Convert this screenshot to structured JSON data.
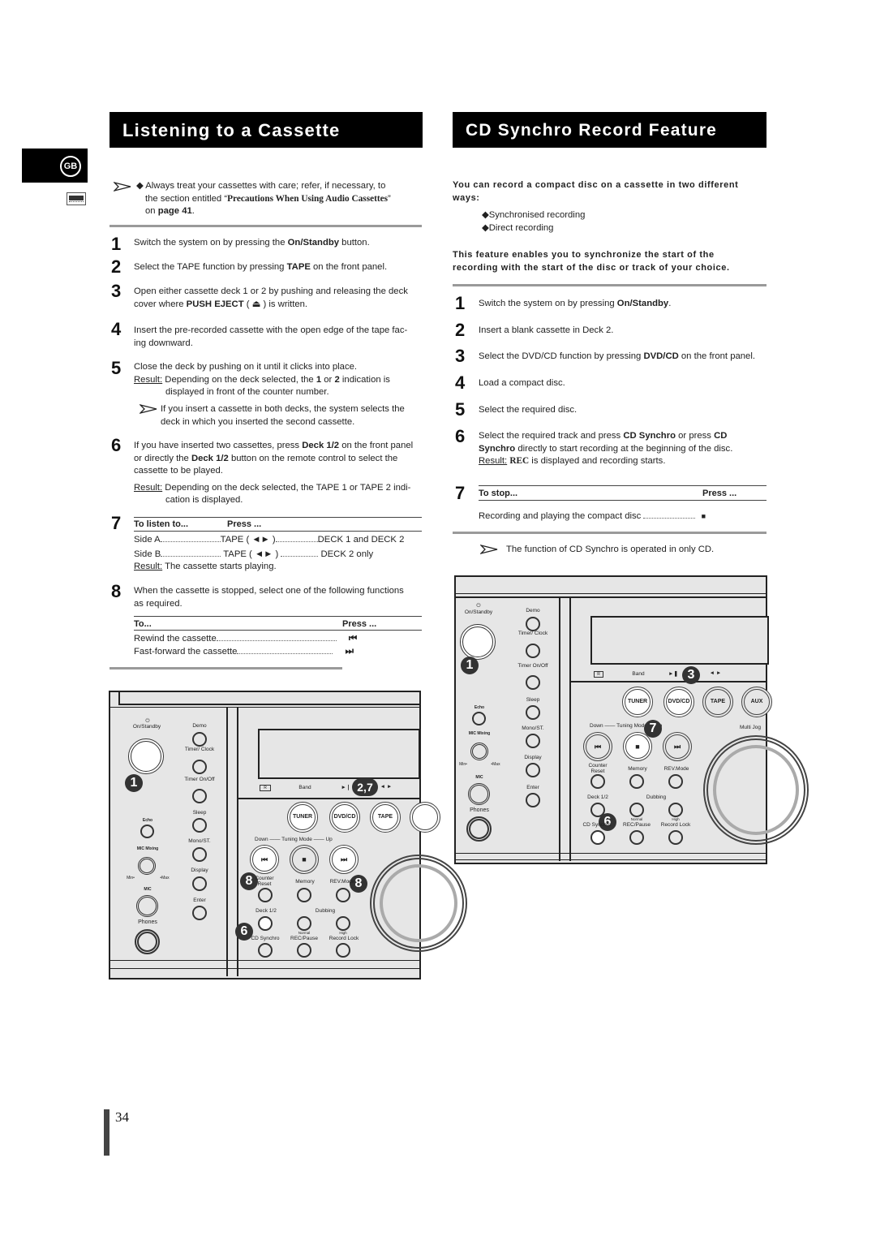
{
  "sidebar": {
    "language_badge": "GB",
    "icon": "cassette-icon"
  },
  "left": {
    "title": "Listening to a Cassette",
    "note": {
      "prefix": "Always treat your cassettes with care; refer, if necessary, to",
      "line2_pre": "the section entitled “",
      "ref": "Precautions When Using Audio Cassettes",
      "line2_post": "”",
      "line3_pre": "on ",
      "page_ref": "page 41",
      "line3_post": "."
    },
    "steps": [
      {
        "n": "1",
        "text_pre": "Switch the system on by pressing the ",
        "bold": "On/Standby",
        "text_post": " button."
      },
      {
        "n": "2",
        "text_pre": "Select the TAPE function by pressing ",
        "bold": "TAPE",
        "text_post": " on the front panel."
      },
      {
        "n": "3",
        "line1": "Open either cassette deck 1 or 2 by pushing and releasing the deck",
        "line2_pre": "cover where ",
        "bold": "PUSH EJECT",
        "line2_post": " ( ⏏ ) is written."
      },
      {
        "n": "4",
        "line1": "Insert the pre-recorded cassette with the open edge of the tape fac-",
        "line2": "ing downward."
      },
      {
        "n": "5",
        "line1": "Close the deck by pushing on it until it clicks into place.",
        "result_label": "Result:",
        "result_pre": " Depending on the deck selected, the ",
        "b1": "1",
        "mid": " or ",
        "b2": "2",
        "result_post": " indication is",
        "result_line2": "displayed in front of the counter number.",
        "tip1": "If you insert a cassette in both decks, the system selects the",
        "tip2": "deck in which you inserted the second cassette."
      },
      {
        "n": "6",
        "line1_pre": "If you have inserted two cassettes, press ",
        "line1_bold": "Deck 1/2",
        "line1_post": " on the front panel",
        "line2_pre": "or directly the ",
        "line2_bold": "Deck 1/2",
        "line2_post": " button on the remote control to select the",
        "line3": "cassette to be played.",
        "result_label": "Result:",
        "result_text": " Depending on the deck selected, the TAPE 1 or TAPE 2 indi-",
        "result_line2": "cation is displayed."
      },
      {
        "n": "7",
        "col1": "To listen to...",
        "col2": "Press ...",
        "rows": [
          {
            "side": "Side A",
            "press": "TAPE ( ◄► )",
            "deck": "DECK 1 and DECK 2"
          },
          {
            "side": "Side B",
            "press": "TAPE ( ◄► )",
            "deck": "DECK 2  only"
          }
        ],
        "result_label": "Result:",
        "result_text": " The cassette starts playing."
      },
      {
        "n": "8",
        "line1": "When the cassette is stopped, select one of the following functions",
        "line2": "as required.",
        "col1": "To...",
        "col2": "Press ...",
        "rows": [
          {
            "action": "Rewind the cassette",
            "icon": "⏮"
          },
          {
            "action": "Fast-forward the cassette",
            "icon": "⏭"
          }
        ]
      }
    ]
  },
  "right": {
    "title": "CD Synchro Record Feature",
    "intro1": "You can record a compact disc on a cassette in two different",
    "intro2": "ways:",
    "bullets": [
      "Synchronised recording",
      "Direct recording"
    ],
    "intro3": "This feature enables you to synchronize the start of the",
    "intro4": "recording with the start of the disc or track of your choice.",
    "steps": [
      {
        "n": "1",
        "pre": "Switch the system on by pressing ",
        "bold": "On/Standby",
        "post": "."
      },
      {
        "n": "2",
        "pre": "Insert a blank cassette in Deck 2.",
        "bold": "",
        "post": ""
      },
      {
        "n": "3",
        "pre": "Select the DVD/CD function by pressing ",
        "bold": "DVD/CD",
        "post": " on the front panel."
      },
      {
        "n": "4",
        "pre": "Load a compact disc.",
        "bold": "",
        "post": ""
      },
      {
        "n": "5",
        "pre": "Select the required disc.",
        "bold": "",
        "post": ""
      },
      {
        "n": "6",
        "line1_pre": "Select the required track and press ",
        "line1_bold": "CD Synchro",
        "line1_mid": " or press ",
        "line1_bold2": "CD",
        "line2_bold": "Synchro",
        "line2_post": " directly to start recording at the beginning of the disc.",
        "result_label": "Result:",
        "result_rec": "REC",
        "result_post": " is displayed and recording starts."
      },
      {
        "n": "7",
        "col1": "To stop...",
        "col2": "Press ...",
        "row": "Recording and playing the compact disc",
        "icon": "■"
      }
    ],
    "note": "The function of CD Synchro is operated in only CD."
  },
  "panel": {
    "on_standby": "On/Standby",
    "demo": "Demo",
    "timer_clock": "Timer/ Clock",
    "timer_onoff": "Timer On/Off",
    "sleep": "Sleep",
    "echo": "Echo",
    "mono_st": "Mono/ST.",
    "mic_mixing": "MIC Mixing",
    "min": "Min•",
    "max": "•Max",
    "display": "Display",
    "mic": "MIC",
    "enter": "Enter",
    "phones": "Phones",
    "r_mark": "R",
    "band": "Band",
    "play_pause": "►❘❘",
    "tape_dir": "◄ ►",
    "tuner": "TUNER",
    "dvd_cd": "DVD/CD",
    "tape": "TAPE",
    "aux": "AUX",
    "down": "Down",
    "tuning_mode": "Tuning Mode",
    "up": "Up",
    "multi_jog": "Multi Jog",
    "counter_reset": "Counter Reset",
    "memory": "Memory",
    "rev_mode": "REV.Mode",
    "deck12": "Deck 1/2",
    "dubbing": "Dubbing",
    "normal": "Normal",
    "high": "High",
    "cd_synchro": "CD Synchro",
    "rec_pause": "REC/Pause",
    "record_lock": "Record Lock",
    "prev": "⏮",
    "stop": "■",
    "next": "⏭",
    "left_badges": {
      "power": "1",
      "tape": "2,7",
      "prev": "8",
      "next": "8",
      "deck": "6"
    },
    "right_badges": {
      "power": "1",
      "dvdcd": "3",
      "stop": "7",
      "cdsynchro": "6"
    }
  },
  "footer": {
    "page_number": "34"
  }
}
